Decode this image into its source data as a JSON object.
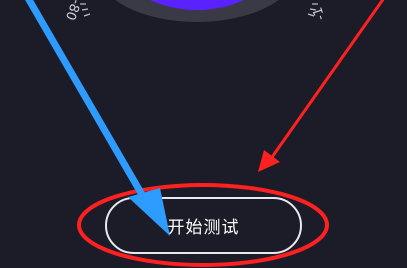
{
  "gauge": {
    "scale_left_label": "-80",
    "scale_right_label": "-1"
  },
  "action": {
    "start_label": "开始测试"
  },
  "colors": {
    "background": "#1c1b28",
    "gauge_ring": "#4a4a56",
    "gauge_core": "#5a22ff",
    "annotation_blue": "#2e9bff",
    "annotation_red": "#ff2020"
  }
}
